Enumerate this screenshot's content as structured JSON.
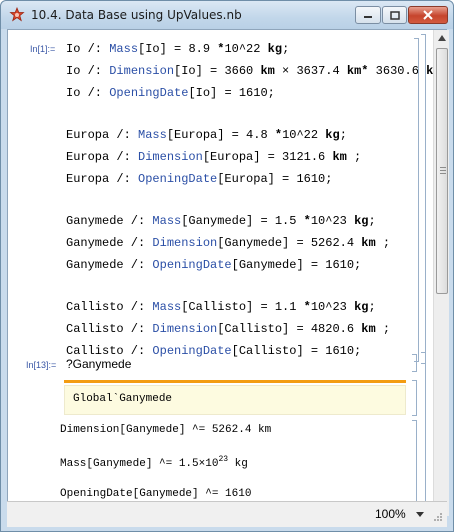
{
  "window": {
    "title": "10.4. Data Base using UpValues.nb",
    "zoom": "100%"
  },
  "cells": {
    "in1_label": "In[1]:=",
    "io": [
      {
        "lhs": "Io /: ",
        "head": "Mass",
        "arg": "[Io] = 8.9 ",
        "mid": "10^22 ",
        "unit": "kg",
        "tail": ";"
      },
      {
        "lhs": "Io /: ",
        "head": "Dimension",
        "arg": "[Io] = 3660 ",
        "unit1": "km",
        "mid": " × 3637.4 ",
        "unit2": "km",
        "mid2": " 3630.6 ",
        "unit3": "km",
        "tail": ";"
      },
      {
        "lhs": "Io /: ",
        "head": "OpeningDate",
        "arg": "[Io] = 1610;"
      }
    ],
    "europa": [
      {
        "lhs": "Europa /: ",
        "head": "Mass",
        "arg": "[Europa] = 4.8 ",
        "mid": "10^22 ",
        "unit": "kg",
        "tail": ";"
      },
      {
        "lhs": "Europa /: ",
        "head": "Dimension",
        "arg": "[Europa] = 3121.6 ",
        "unit": "km",
        "tail": " ;"
      },
      {
        "lhs": "Europa /: ",
        "head": "OpeningDate",
        "arg": "[Europa] = 1610;"
      }
    ],
    "ganymede": [
      {
        "lhs": "Ganymede /: ",
        "head": "Mass",
        "arg": "[Ganymede] = 1.5 ",
        "mid": "10^23 ",
        "unit": "kg",
        "tail": ";"
      },
      {
        "lhs": "Ganymede /: ",
        "head": "Dimension",
        "arg": "[Ganymede] = 5262.4 ",
        "unit": "km",
        "tail": " ;"
      },
      {
        "lhs": "Ganymede /: ",
        "head": "OpeningDate",
        "arg": "[Ganymede] = 1610;"
      }
    ],
    "callisto": [
      {
        "lhs": "Callisto /: ",
        "head": "Mass",
        "arg": "[Callisto] = 1.1 ",
        "mid": "10^23 ",
        "unit": "kg",
        "tail": ";"
      },
      {
        "lhs": "Callisto /: ",
        "head": "Dimension",
        "arg": "[Callisto] = 4820.6 ",
        "unit": "km",
        "tail": " ;"
      },
      {
        "lhs": "Callisto /: ",
        "head": "OpeningDate",
        "arg": "[Callisto] = 1610;"
      }
    ],
    "in13_label": "In[13]:=",
    "in13_query": "?Ganymede",
    "info_symbol": "Global`Ganymede",
    "out_dimension": "Dimension[Ganymede] ^= 5262.4 km",
    "out_mass_prefix": "Mass[Ganymede] ^= 1.5×10",
    "out_mass_exp": "23",
    "out_mass_unit": " kg",
    "out_opening": "OpeningDate[Ganymede] ^= 1610"
  }
}
